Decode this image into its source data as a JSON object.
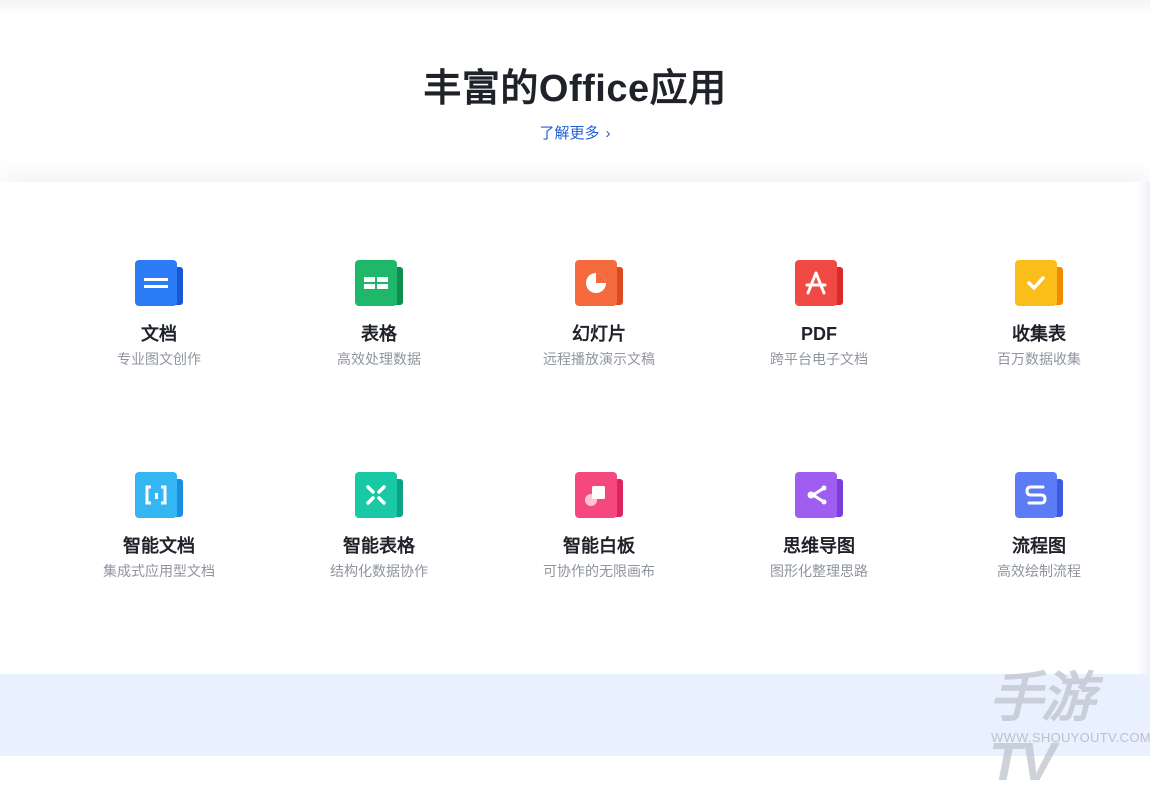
{
  "hero": {
    "title": "丰富的Office应用",
    "link_label": "了解更多",
    "link_chevron": "›"
  },
  "apps": [
    {
      "name": "文档",
      "desc": "专业图文创作",
      "icon": "doc-icon",
      "colors": [
        "#2b7cf6",
        "#1a56d8"
      ]
    },
    {
      "name": "表格",
      "desc": "高效处理数据",
      "icon": "sheet-icon",
      "colors": [
        "#1fb86a",
        "#0e8f4c"
      ]
    },
    {
      "name": "幻灯片",
      "desc": "远程播放演示文稿",
      "icon": "slides-icon",
      "colors": [
        "#f56a3c",
        "#dc4b1f"
      ]
    },
    {
      "name": "PDF",
      "desc": "跨平台电子文档",
      "icon": "pdf-icon",
      "colors": [
        "#f14a45",
        "#d92b2b"
      ]
    },
    {
      "name": "收集表",
      "desc": "百万数据收集",
      "icon": "form-icon",
      "colors": [
        "#fbbd1a",
        "#f28b00"
      ]
    },
    {
      "name": "智能文档",
      "desc": "集成式应用型文档",
      "icon": "smart-doc-icon",
      "colors": [
        "#33b6f2",
        "#1a8fe0"
      ]
    },
    {
      "name": "智能表格",
      "desc": "结构化数据协作",
      "icon": "smart-sheet-icon",
      "colors": [
        "#19c9a6",
        "#0ba286"
      ]
    },
    {
      "name": "智能白板",
      "desc": "可协作的无限画布",
      "icon": "whiteboard-icon",
      "colors": [
        "#f5487f",
        "#dc2463"
      ]
    },
    {
      "name": "思维导图",
      "desc": "图形化整理思路",
      "icon": "mindmap-icon",
      "colors": [
        "#a05ef0",
        "#7a3ddb"
      ]
    },
    {
      "name": "流程图",
      "desc": "高效绘制流程",
      "icon": "flowchart-icon",
      "colors": [
        "#5b7cf6",
        "#3e5ade"
      ]
    }
  ],
  "watermark": {
    "big": "手游TV",
    "small": "WWW.SHOUYOUTV.COM"
  }
}
